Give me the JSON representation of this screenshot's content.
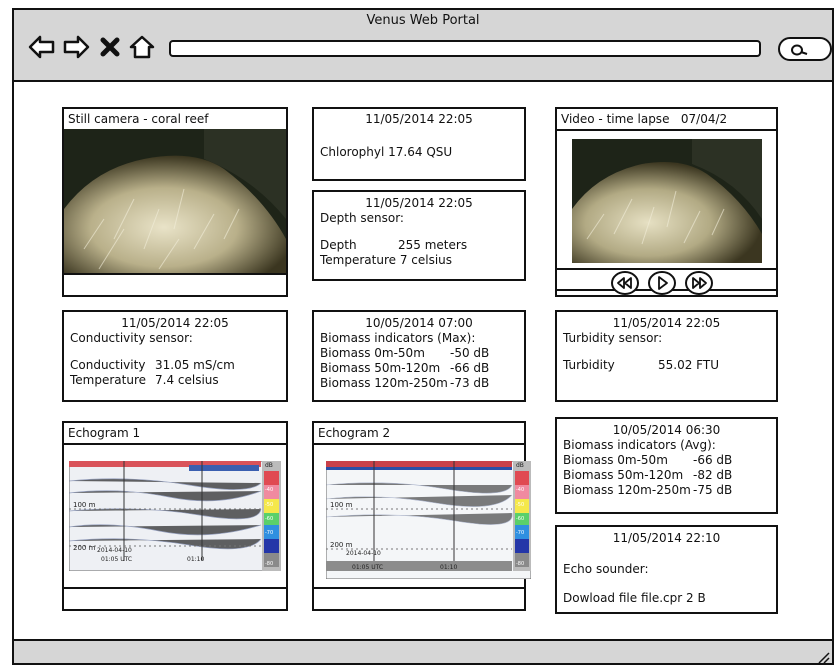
{
  "window": {
    "title": "Venus Web Portal"
  },
  "browser": {
    "url": ""
  },
  "panels": {
    "still_camera": {
      "title": "Still camera - coral reef"
    },
    "chlorophyll": {
      "timestamp": "11/05/2014 22:05",
      "line": "Chlorophyl 17.64 QSU"
    },
    "depth": {
      "timestamp": "11/05/2014 22:05",
      "label": "Depth sensor:",
      "depth_name": "Depth",
      "depth_value": "255 meters",
      "temperature": "Temperature 7 celsius"
    },
    "video": {
      "title": "Video - time lapse",
      "date": "07/04/2"
    },
    "conductivity": {
      "timestamp": "11/05/2014 22:05",
      "label": "Conductivity sensor:",
      "cond_name": "Conductivity",
      "cond_value": "31.05 mS/cm",
      "temp_name": "Temperature",
      "temp_value": "7.4 celsius"
    },
    "biomass_max": {
      "timestamp": "10/05/2014 07:00",
      "label": "Biomass indicators (Max):",
      "rows": [
        {
          "name": "Biomass 0m-50m",
          "value": "-50 dB"
        },
        {
          "name": "Biomass 50m-120m",
          "value": "-66 dB"
        },
        {
          "name": "Biomass 120m-250m",
          "value": "-73 dB"
        }
      ]
    },
    "turbidity": {
      "timestamp": "11/05/2014 22:05",
      "label": "Turbidity sensor:",
      "name": "Turbidity",
      "value": "55.02 FTU"
    },
    "echogram1": {
      "title": "Echogram 1",
      "depth_a": "100 m",
      "depth_b": "200 m",
      "date": "2014-04-10",
      "time_a": "01:05 UTC",
      "time_b": "01:10",
      "unit": "dB",
      "scale": [
        "-40",
        "-50",
        "-60",
        "-70",
        "-80"
      ]
    },
    "echogram2": {
      "title": "Echogram 2",
      "depth_a": "100 m",
      "depth_b": "200 m",
      "date": "2014-04-10",
      "time_a": "01:05 UTC",
      "time_b": "01:10",
      "unit": "dB",
      "scale": [
        "-40",
        "-50",
        "-60",
        "-70",
        "-80"
      ]
    },
    "biomass_avg": {
      "timestamp": "10/05/2014 06:30",
      "label": "Biomass indicators (Avg):",
      "rows": [
        {
          "name": "Biomass 0m-50m",
          "value": "-66 dB"
        },
        {
          "name": "Biomass 50m-120m",
          "value": "-82 dB"
        },
        {
          "name": "Biomass 120m-250m",
          "value": "-75 dB"
        }
      ]
    },
    "echo_sounder": {
      "timestamp": "11/05/2014 22:10",
      "label": "Echo sounder:",
      "download": "Dowload file file.cpr 2 B"
    }
  },
  "icons": [
    "back-arrow-icon",
    "forward-arrow-icon",
    "close-x-icon",
    "home-icon",
    "search-icon",
    "rewind-icon",
    "play-icon",
    "fast-forward-icon",
    "resize-grip-icon"
  ]
}
